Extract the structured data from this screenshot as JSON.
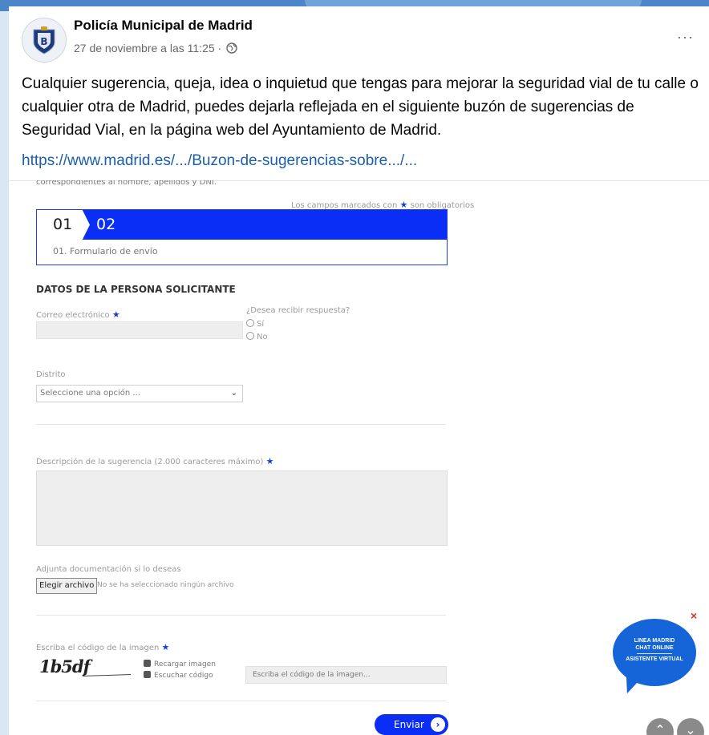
{
  "post": {
    "page_name": "Policía Municipal de Madrid",
    "date": "27 de noviembre a las 11:25 ·",
    "more_label": "···",
    "text": "Cualquier sugerencia, queja, idea o inquietud que tengas para mejorar la seguridad vial de tu calle o cualquier otra de Madrid, puedes dejarla reflejada en el siguiente buzón de sugerencias de Seguridad Vial, en la página web del Ayuntamiento de Madrid.",
    "link": "https://www.madrid.es/.../Buzon-de-sugerencias-sobre.../..."
  },
  "form": {
    "cut_text": "correspondientes al nombre, apellidos y DNI.",
    "required_note": "Los campos marcados con",
    "required_note_end": "son obligatorios",
    "step1": "01",
    "step2": "02",
    "step_caption": "01. Formulario de envío",
    "section_title": "DATOS DE LA PERSONA SOLICITANTE",
    "email_label": "Correo electrónico",
    "response_label": "¿Desea recibir respuesta?",
    "opt_yes": "Sí",
    "opt_no": "No",
    "district_label": "Distrito",
    "district_value": "Seleccione una opción ...",
    "description_label": "Descripción de la sugerencia (2.000 caracteres máximo)",
    "attach_label": "Adjunta documentación si lo deseas",
    "file_button": "Elegir archivo",
    "file_status": "No se ha seleccionado ningún archivo",
    "captcha_label": "Escriba el código de la imagen",
    "captcha_text": "1b5df",
    "reload_label": "Recargar imagen",
    "listen_label": "Escuchar código",
    "captcha_placeholder": "Escriba el código de la imagen...",
    "send_label": "Enviar"
  },
  "chat": {
    "line1": "LINEA MADRID",
    "line2": "CHAT ONLINE",
    "line3": "ASISTENTE VIRTUAL",
    "close": "×"
  },
  "colors": {
    "accent": "#0a2ef5",
    "link": "#1b5fa8",
    "chat": "#1565d8"
  }
}
